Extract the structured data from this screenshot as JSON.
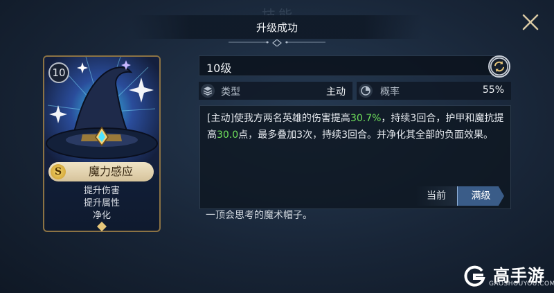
{
  "header": {
    "ghost_text": "技能",
    "title": "升级成功"
  },
  "card": {
    "level": "10",
    "grade_letter": "S",
    "skill_name": "魔力感应",
    "effects": [
      "提升伤害",
      "提升属性",
      "净化"
    ]
  },
  "skill": {
    "level_label": "10级",
    "type_label": "类型",
    "type_value": "主动",
    "rate_label": "概率",
    "rate_value": "55%",
    "description": {
      "p1": "[主动]使我方两名英雄的伤害提高",
      "v1": "30.7%",
      "p2": "，持续3回合，护甲和魔抗提高",
      "v2": "30.0",
      "p3": "点，最多叠加3次，持续3回合。并净化其全部的负面效果。"
    },
    "highlight_color": "#6fe05b"
  },
  "tabs": {
    "current_label": "当前",
    "max_label": "满级",
    "selected": "满级"
  },
  "flavor_text": "一顶会思考的魔术帽子。",
  "watermark": {
    "name": "高手游",
    "url": "GAOSHOUYOU.COM"
  },
  "icons": [
    "close-icon",
    "refresh-icon",
    "layers-icon",
    "chance-icon",
    "wizard-hat-icon",
    "sparkle-icon"
  ]
}
